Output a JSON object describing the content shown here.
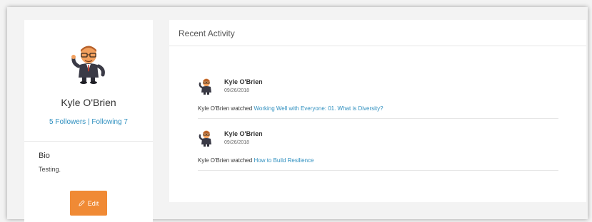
{
  "profile": {
    "name": "Kyle O'Brien",
    "followers": "5 Followers",
    "separator": "|",
    "following": "Following 7",
    "bio_label": "Bio",
    "bio_text": "Testing.",
    "edit_label": "Edit",
    "avatar_icon": "cartoon-man-avatar-icon"
  },
  "activity": {
    "title": "Recent Activity",
    "items": [
      {
        "user": "Kyle O'Brien",
        "date": "09/26/2018",
        "action": "Kyle O'Brien watched",
        "link": "Working Well with Everyone: 01. What is Diversity?"
      },
      {
        "user": "Kyle O'Brien",
        "date": "09/26/2018",
        "action": "Kyle O'Brien watched",
        "link": "How to Build Resilience"
      }
    ]
  },
  "colors": {
    "accent_link": "#2e8fbf",
    "edit_button": "#f08a35",
    "background": "#f3f3f3"
  }
}
